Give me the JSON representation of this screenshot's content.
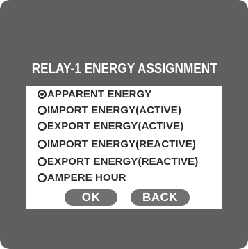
{
  "dialog": {
    "title": "RELAY-1 ENERGY ASSIGNMENT",
    "options": [
      {
        "label": "APPARENT ENERGY",
        "selected": true
      },
      {
        "label": "IMPORT ENERGY(ACTIVE)",
        "selected": false
      },
      {
        "label": "EXPORT ENERGY(ACTIVE)",
        "selected": false
      },
      {
        "label": "IMPORT ENERGY(REACTIVE)",
        "selected": false
      },
      {
        "label": "EXPORT ENERGY(REACTIVE)",
        "selected": false
      },
      {
        "label": "AMPERE HOUR",
        "selected": false
      }
    ],
    "ok_label": "OK",
    "back_label": "BACK"
  },
  "colors": {
    "screen_background": "#5f5f5f",
    "dialog_body": "#ffffff",
    "text": "#2a2a2a",
    "button": "#707070"
  }
}
